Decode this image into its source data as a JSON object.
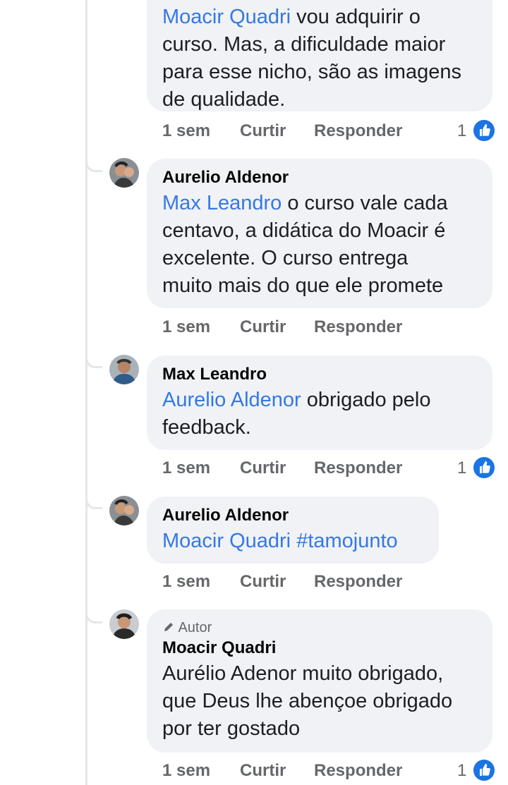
{
  "comments": [
    {
      "name": "",
      "text_lines": [
        "Moacir Quadri vou adquirir o",
        "curso. Mas, a dificuldade maior",
        "para esse nicho, são as imagens",
        "de qualidade."
      ],
      "mention": "Moacir Quadri",
      "time": "1 sem",
      "like_label": "Curtir",
      "reply_label": "Responder",
      "likes": "1"
    },
    {
      "name": "Aurelio Aldenor",
      "mention": "Max Leandro",
      "text_line1_rest": " o curso vale cada",
      "text_lines": [
        "centavo, a didática do Moacir é",
        "excelente. O curso entrega",
        "muito mais do que ele promete"
      ],
      "time": "1 sem",
      "like_label": "Curtir",
      "reply_label": "Responder"
    },
    {
      "name": "Max Leandro",
      "mention": "Aurelio Aldenor",
      "text_line1_rest": " obrigado pelo",
      "text_lines": [
        "feedback."
      ],
      "time": "1 sem",
      "like_label": "Curtir",
      "reply_label": "Responder",
      "likes": "1"
    },
    {
      "name": "Aurelio Aldenor",
      "mention": "Moacir Quadri",
      "hashtag": "#tamojunto",
      "time": "1 sem",
      "like_label": "Curtir",
      "reply_label": "Responder"
    },
    {
      "badge": "Autor",
      "name": "Moacir Quadri",
      "text_lines": [
        "Aurélio Adenor muito obrigado,",
        "que Deus lhe abençoe obrigado",
        "por ter gostado"
      ],
      "time": "1 sem",
      "like_label": "Curtir",
      "reply_label": "Responder",
      "likes": "1"
    }
  ],
  "colors": {
    "mention": "#3578e5",
    "bubble": "#f0f2f5",
    "like": "#1b74e4"
  },
  "icons": {
    "like": "thumbs-up-icon",
    "author": "pencil-icon"
  }
}
